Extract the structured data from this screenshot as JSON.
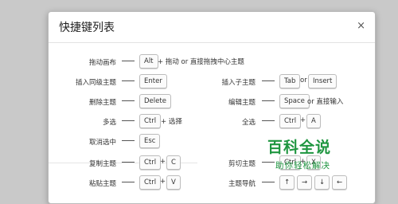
{
  "dialog": {
    "title": "快捷键列表",
    "close_symbol": "×"
  },
  "shortcuts": {
    "drag_canvas": {
      "label": "拖动画布",
      "key1": "Alt",
      "desc": "+ 拖动 or 直接拖拽中心主题"
    },
    "insert_sibling": {
      "label": "插入同级主题",
      "key1": "Enter"
    },
    "insert_child": {
      "label": "插入子主题",
      "key1": "Tab",
      "or": "or",
      "key2": "Insert"
    },
    "delete_topic": {
      "label": "删除主题",
      "key1": "Delete"
    },
    "edit_topic": {
      "label": "编辑主题",
      "key1": "Space",
      "desc": "or 直接输入"
    },
    "multi_select": {
      "label": "多选",
      "key1": "Ctrl",
      "desc": "+ 选择"
    },
    "select_all": {
      "label": "全选",
      "key1": "Ctrl",
      "plus": "+",
      "key2": "A"
    },
    "cancel_select": {
      "label": "取消选中",
      "key1": "Esc"
    },
    "copy_topic": {
      "label": "复制主题",
      "key1": "Ctrl",
      "plus": "+",
      "key2": "C"
    },
    "cut_topic": {
      "label": "剪切主题",
      "key1": "Ctrl",
      "plus": "+",
      "key2": "X"
    },
    "paste_topic": {
      "label": "粘贴主题",
      "key1": "Ctrl",
      "plus": "+",
      "key2": "V"
    },
    "topic_nav": {
      "label": "主题导航",
      "keys": [
        "↑",
        "→",
        "↓",
        "←"
      ]
    }
  },
  "watermark": {
    "title": "百科全说",
    "subtitle": "助你轻松解决"
  }
}
